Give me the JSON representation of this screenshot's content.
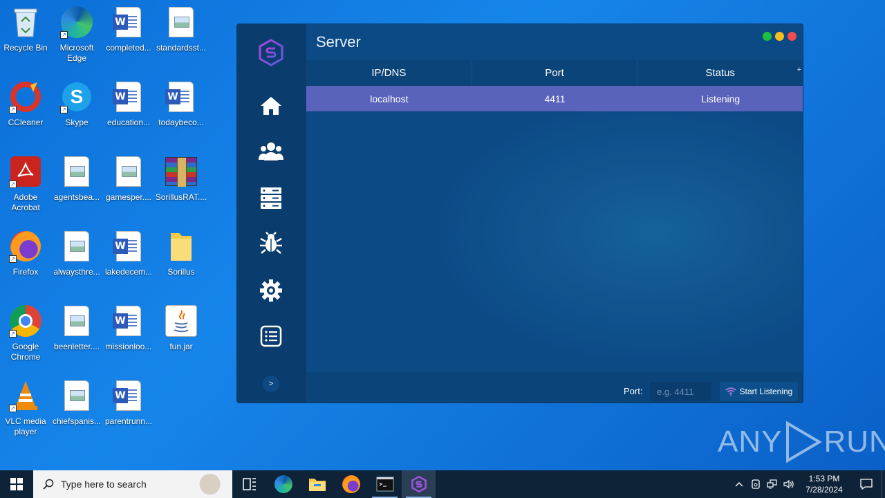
{
  "desktop": {
    "icons": [
      {
        "label": "Recycle Bin"
      },
      {
        "label": "Microsoft\nEdge"
      },
      {
        "label": "completed..."
      },
      {
        "label": "standardsst..."
      },
      {
        "label": "CCleaner"
      },
      {
        "label": "Skype"
      },
      {
        "label": "education..."
      },
      {
        "label": "todaybeco..."
      },
      {
        "label": "Adobe\nAcrobat"
      },
      {
        "label": "agentsbea..."
      },
      {
        "label": "gamesper...."
      },
      {
        "label": "SorillusRAT...."
      },
      {
        "label": "Firefox"
      },
      {
        "label": "alwaysthre..."
      },
      {
        "label": "lakedecem..."
      },
      {
        "label": "Sorillus"
      },
      {
        "label": "Google\nChrome"
      },
      {
        "label": "beenletter...."
      },
      {
        "label": "missionloo..."
      },
      {
        "label": "fun.jar"
      },
      {
        "label": "VLC media\nplayer"
      },
      {
        "label": "chiefspanis..."
      },
      {
        "label": "parentrunn..."
      }
    ]
  },
  "window": {
    "title": "Server",
    "columns": [
      "IP/DNS",
      "Port",
      "Status"
    ],
    "rows": [
      {
        "host": "localhost",
        "port": "4411",
        "status": "Listening"
      }
    ],
    "port_label": "Port:",
    "port_placeholder": "e.g. 4411",
    "listen_button": "Start Listening",
    "collapse_label": ">",
    "accent": "#5a63bb"
  },
  "watermark": {
    "left": "ANY",
    "right": "RUN"
  },
  "taskbar": {
    "search_placeholder": "Type here to search",
    "time": "1:53 PM",
    "date": "7/28/2024"
  }
}
